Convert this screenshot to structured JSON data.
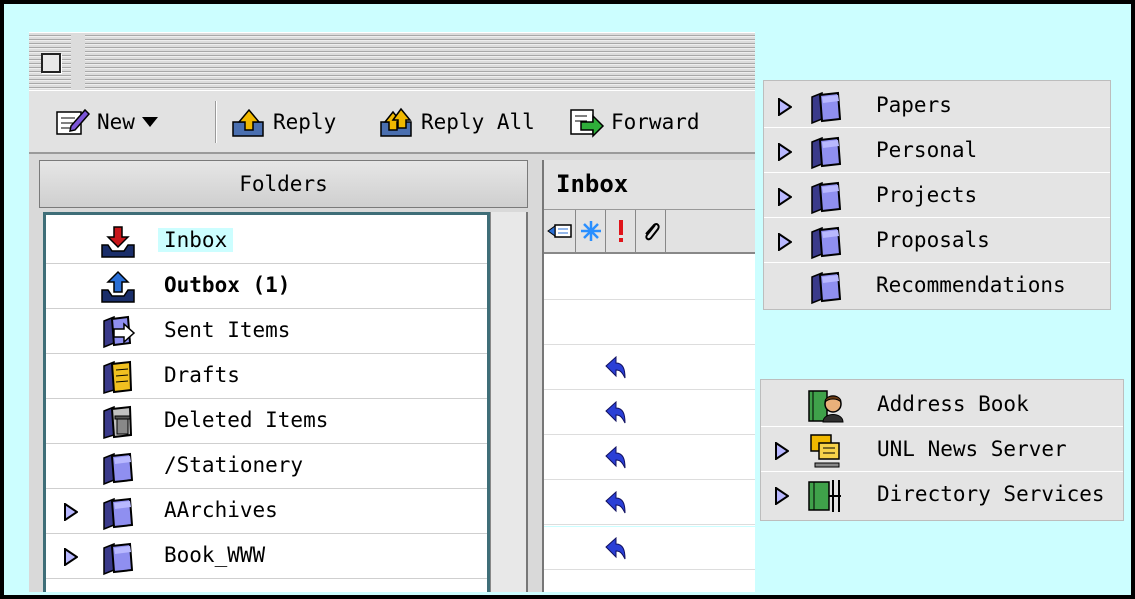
{
  "toolbar": {
    "new_label": "New",
    "reply_label": "Reply",
    "reply_all_label": "Reply All",
    "forward_label": "Forward"
  },
  "folders": {
    "header": "Folders",
    "items": [
      {
        "label": "Inbox",
        "icon": "inbox-icon",
        "expandable": false
      },
      {
        "label": "Outbox (1)",
        "icon": "outbox-icon",
        "expandable": false
      },
      {
        "label": "Sent Items",
        "icon": "sent-items-icon",
        "expandable": false
      },
      {
        "label": "Drafts",
        "icon": "drafts-icon",
        "expandable": false
      },
      {
        "label": "Deleted Items",
        "icon": "trash-icon",
        "expandable": false
      },
      {
        "label": "/Stationery",
        "icon": "folder-icon",
        "expandable": false
      },
      {
        "label": "AArchives",
        "icon": "folder-icon",
        "expandable": true
      },
      {
        "label": "Book_WWW",
        "icon": "folder-icon",
        "expandable": true
      }
    ]
  },
  "inbox": {
    "title": "Inbox",
    "column_icons": [
      "collapse-icon",
      "new-status-icon",
      "priority-icon",
      "attachment-icon"
    ],
    "replied_rows": 5
  },
  "folder_panel": {
    "items": [
      {
        "label": "Papers",
        "expandable": true
      },
      {
        "label": "Personal",
        "expandable": true
      },
      {
        "label": "Projects",
        "expandable": true
      },
      {
        "label": "Proposals",
        "expandable": true
      },
      {
        "label": "Recommendations",
        "expandable": false
      }
    ]
  },
  "services_panel": {
    "items": [
      {
        "label": "Address Book",
        "icon": "address-book-icon",
        "expandable": false
      },
      {
        "label": "UNL News Server",
        "icon": "news-server-icon",
        "expandable": true
      },
      {
        "label": "Directory Services",
        "icon": "directory-icon",
        "expandable": true
      }
    ]
  },
  "colors": {
    "background": "#ccfeff",
    "selection": "#ccfeff",
    "list_border": "#3f6e78",
    "reply_arrow": "#2a3fd6"
  }
}
